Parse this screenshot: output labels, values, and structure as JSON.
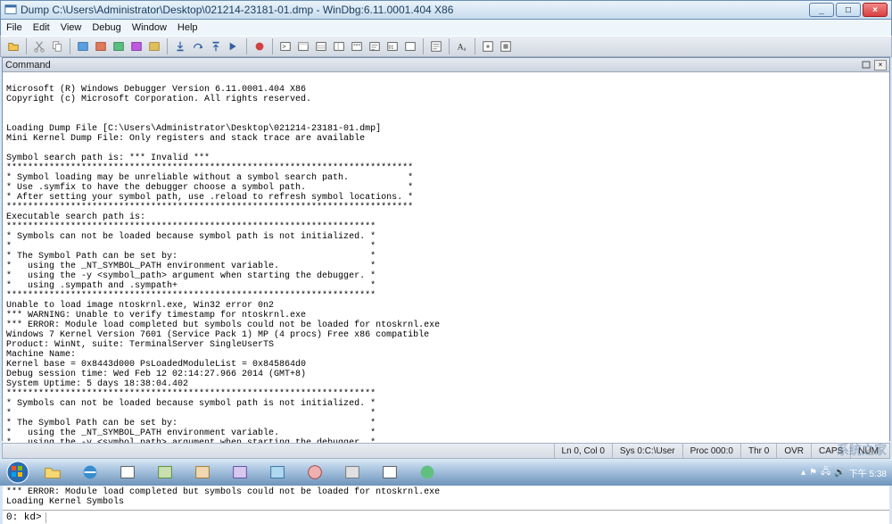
{
  "window": {
    "title": "Dump C:\\Users\\Administrator\\Desktop\\021214-23181-01.dmp - WinDbg:6.11.0001.404 X86",
    "min": "_",
    "max": "□",
    "close": "×"
  },
  "menu": {
    "file": "File",
    "edit": "Edit",
    "view": "View",
    "debug": "Debug",
    "window": "Window",
    "help": "Help"
  },
  "command_panel": {
    "title": "Command",
    "close": "×"
  },
  "output": "\nMicrosoft (R) Windows Debugger Version 6.11.0001.404 X86\nCopyright (c) Microsoft Corporation. All rights reserved.\n\n\nLoading Dump File [C:\\Users\\Administrator\\Desktop\\021214-23181-01.dmp]\nMini Kernel Dump File: Only registers and stack trace are available\n\nSymbol search path is: *** Invalid ***\n****************************************************************************\n* Symbol loading may be unreliable without a symbol search path.           *\n* Use .symfix to have the debugger choose a symbol path.                   *\n* After setting your symbol path, use .reload to refresh symbol locations. *\n****************************************************************************\nExecutable search path is:\n*********************************************************************\n* Symbols can not be loaded because symbol path is not initialized. *\n*                                                                   *\n* The Symbol Path can be set by:                                    *\n*   using the _NT_SYMBOL_PATH environment variable.                 *\n*   using the -y <symbol_path> argument when starting the debugger. *\n*   using .sympath and .sympath+                                    *\n*********************************************************************\nUnable to load image ntoskrnl.exe, Win32 error 0n2\n*** WARNING: Unable to verify timestamp for ntoskrnl.exe\n*** ERROR: Module load completed but symbols could not be loaded for ntoskrnl.exe\nWindows 7 Kernel Version 7601 (Service Pack 1) MP (4 procs) Free x86 compatible\nProduct: WinNt, suite: TerminalServer SingleUserTS\nMachine Name:\nKernel base = 0x8443d000 PsLoadedModuleList = 0x845864d0\nDebug session time: Wed Feb 12 02:14:27.966 2014 (GMT+8)\nSystem Uptime: 5 days 18:38:04.402\n*********************************************************************\n* Symbols can not be loaded because symbol path is not initialized. *\n*                                                                   *\n* The Symbol Path can be set by:                                    *\n*   using the _NT_SYMBOL_PATH environment variable.                 *\n*   using the -y <symbol_path> argument when starting the debugger. *\n*   using .sympath and .sympath+                                    *\n*********************************************************************\nUnable to load image ntoskrnl.exe, Win32 error 0n2\n*** WARNING: Unable to verify timestamp for ntoskrnl.exe\n*** ERROR: Module load completed but symbols could not be loaded for ntoskrnl.exe\nLoading Kernel Symbols",
  "prompt": "0: kd>",
  "status": {
    "ln": "Ln 0, Col 0",
    "sys": "Sys 0:C:\\User",
    "proc": "Proc 000:0",
    "thr": "Thr 0",
    "ovr": "OVR",
    "caps": "CAPS",
    "num": "NUM"
  },
  "tray": {
    "time": "下午 5:38"
  },
  "watermark": "系统之家"
}
